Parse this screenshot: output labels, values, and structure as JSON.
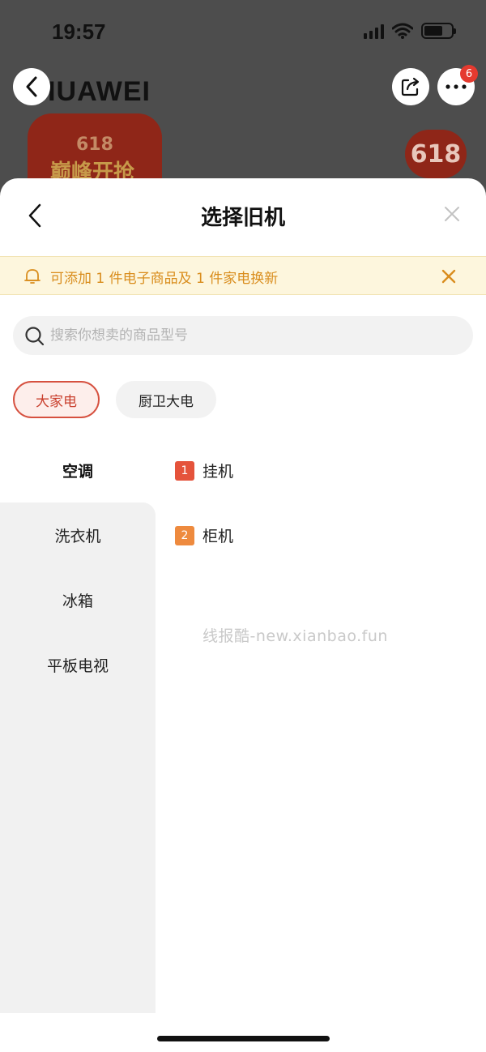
{
  "status_bar": {
    "time": "19:57"
  },
  "background_page": {
    "brand": "HUAWEI",
    "promo_top": "618",
    "promo_bottom": "巅峰开抢",
    "promo_right": "618",
    "notification_count": "6"
  },
  "sheet": {
    "title": "选择旧机",
    "notice": "可添加 1 件电子商品及 1 件家电换新",
    "search_placeholder": "搜索你想卖的商品型号",
    "chips": [
      {
        "label": "大家电",
        "active": true
      },
      {
        "label": "厨卫大电",
        "active": false
      }
    ],
    "categories": [
      {
        "label": "空调",
        "active": true
      },
      {
        "label": "洗衣机",
        "active": false
      },
      {
        "label": "冰箱",
        "active": false
      },
      {
        "label": "平板电视",
        "active": false
      }
    ],
    "sub_items": [
      {
        "rank": "1",
        "label": "挂机",
        "rank_color": "#e5533b"
      },
      {
        "rank": "2",
        "label": "柜机",
        "rank_color": "#ee8a3e"
      }
    ]
  },
  "watermark": "线报酷-new.xianbao.fun",
  "colors": {
    "accent": "#d6503f",
    "notice_text": "#d98d1d",
    "notice_bg": "#fdf6dd"
  }
}
